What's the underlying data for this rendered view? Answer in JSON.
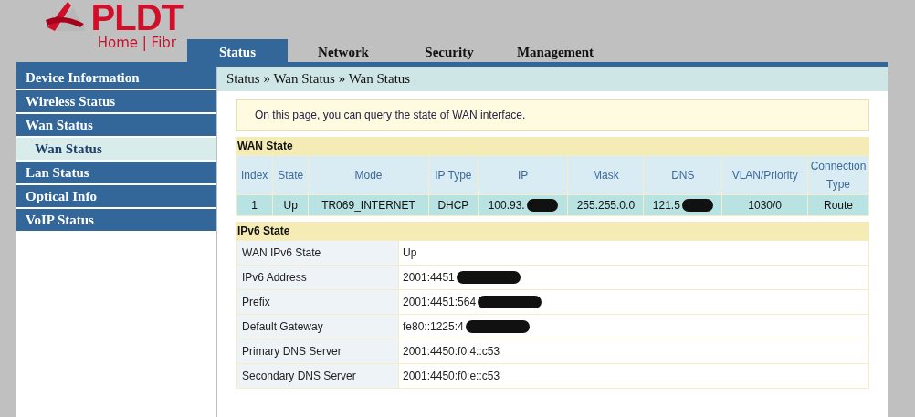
{
  "logo": {
    "brand": "PLDT",
    "tagline": "Home | Fibr"
  },
  "tabs": [
    {
      "label": "Status",
      "selected": true
    },
    {
      "label": "Network",
      "selected": false
    },
    {
      "label": "Security",
      "selected": false
    },
    {
      "label": "Management",
      "selected": false
    }
  ],
  "sidebar": {
    "items": [
      {
        "label": "Device Information",
        "selected": false
      },
      {
        "label": "Wireless Status",
        "selected": false
      },
      {
        "label": "Wan Status",
        "selected": false,
        "children": [
          {
            "label": "Wan Status",
            "selected": true
          }
        ]
      },
      {
        "label": "Lan Status",
        "selected": false
      },
      {
        "label": "Optical Info",
        "selected": false
      },
      {
        "label": "VoIP Status",
        "selected": false
      }
    ]
  },
  "breadcrumb": "Status » Wan Status » Wan Status",
  "info": "On this page, you can query the state of WAN interface.",
  "wan_state": {
    "title": "WAN State",
    "columns": [
      "Index",
      "State",
      "Mode",
      "IP Type",
      "IP",
      "Mask",
      "DNS",
      "VLAN/Priority",
      "Connection Type"
    ],
    "rows": [
      [
        {
          "text": "1"
        },
        {
          "text": "Up"
        },
        {
          "text": "TR069_INTERNET"
        },
        {
          "text": "DHCP"
        },
        {
          "text": "100.93.",
          "redacted": true
        },
        {
          "text": "255.255.0.0"
        },
        {
          "text": "121.5",
          "redacted": true
        },
        {
          "text": "1030/0"
        },
        {
          "text": "Route"
        }
      ]
    ]
  },
  "ipv6_state": {
    "title": "IPv6 State",
    "rows": [
      {
        "label": "WAN IPv6 State",
        "value": "Up",
        "redacted": false
      },
      {
        "label": "IPv6 Address",
        "value": "2001:4451",
        "redacted": true
      },
      {
        "label": "Prefix",
        "value": "2001:4451:564",
        "redacted": true
      },
      {
        "label": "Default Gateway",
        "value": "fe80::1225:4",
        "redacted": true
      },
      {
        "label": "Primary DNS Server",
        "value": "2001:4450:f0:4::c53",
        "redacted": false
      },
      {
        "label": "Secondary DNS Server",
        "value": "2001:4450:f0:e::c53",
        "redacted": false
      }
    ]
  }
}
